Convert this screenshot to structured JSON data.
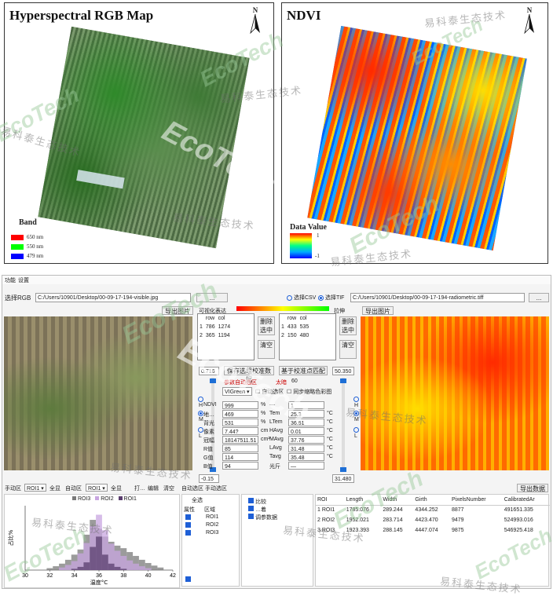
{
  "panel_rgb": {
    "title": "Hyperspectral RGB Map",
    "north": "N",
    "band_title": "Band",
    "bands": [
      {
        "label": "650 nm",
        "color": "#ff0000"
      },
      {
        "label": "550 nm",
        "color": "#00ff00"
      },
      {
        "label": "479 nm",
        "color": "#0000ff"
      }
    ]
  },
  "panel_ndvi": {
    "title": "NDVI",
    "north": "N",
    "legend_title": "Data Value",
    "legend_max": "1",
    "legend_min": "-1"
  },
  "watermark": {
    "en": "EcoTech",
    "cn": "易科泰生态技术"
  },
  "app": {
    "menu": [
      "功能",
      "设置"
    ],
    "select_rgb": "选择RGB",
    "rgb_path": "C:/Users/10901/Desktop/00-09-17-194-visible.jpg",
    "browse": "...",
    "select_csv": "选择CSV",
    "select_tif": "选择TIF",
    "tif_path": "C:/Users/10901/Desktop/00-09-17-194-radiometric.tiff",
    "browse2": "...",
    "export_img_left": "导出图片",
    "export_img_right": "导出图片",
    "vis_label": "可视化表达",
    "bar_right": "拉伸",
    "table_left": {
      "headers": [
        "row",
        "col"
      ],
      "rows": [
        [
          "1",
          "786",
          "1274"
        ],
        [
          "2",
          "365",
          "1194"
        ]
      ]
    },
    "table_right": {
      "headers": [
        "row",
        "col"
      ],
      "rows": [
        [
          "1",
          "433",
          "535"
        ],
        [
          "2",
          "150",
          "480"
        ]
      ]
    },
    "delete_sel": "删除选中",
    "clear": "清空",
    "delete_sel2": "删除选中",
    "clear2": "清空",
    "left_top_val": "0.716",
    "left_bot_val": "-0.15",
    "right_top_val": "50.350",
    "right_bot_val": "31.480",
    "save_reg": "保存选组校准数据",
    "feature_reg": "基于校准点匹配",
    "param_auto": "参数自动选区",
    "too_large": "太暗",
    "too_large_val": "60",
    "vi_select": "VIGreen",
    "auto_select": "自动选区",
    "scan_export": "同步缩略色彩图",
    "metrics_left": [
      {
        "label": "NDVI",
        "value": "999"
      },
      {
        "label": "地…",
        "value": "469"
      },
      {
        "label": "背光",
        "value": "531"
      },
      {
        "label": "像素",
        "value": "7.44?"
      },
      {
        "label": "冠幅",
        "value": "18147511.51"
      },
      {
        "label": "R值",
        "value": "85"
      },
      {
        "label": "G值",
        "value": "114"
      },
      {
        "label": "B值",
        "value": "94"
      }
    ],
    "units_left": [
      "%",
      "%",
      "%",
      "cm",
      "cm²",
      "",
      "",
      ""
    ],
    "metrics_right": [
      {
        "label": "—",
        "value": "1"
      },
      {
        "label": "Tem",
        "value": "25.3"
      },
      {
        "label": "LTem",
        "value": "36.51"
      },
      {
        "label": "HAvg",
        "value": "0.01"
      },
      {
        "label": "MAvg",
        "value": "37.76"
      },
      {
        "label": "LAvg",
        "value": "31.48"
      },
      {
        "label": "Tavg",
        "value": "35.48"
      },
      {
        "label": "光斤",
        "value": "—"
      }
    ],
    "units_right": [
      "",
      "°C",
      "°C",
      "°C",
      "°C",
      "°C",
      "°C",
      ""
    ],
    "radio_h": "H",
    "radio_m": "M",
    "radio_l": "L",
    "bottom_toolbar_left": [
      "手动区",
      "ROI1",
      "全显",
      "自动区",
      "ROI1",
      "全显",
      "打…"
    ],
    "bottom_toolbar_mid": [
      "编辑",
      "清空",
      "自动选区",
      "手动选区"
    ],
    "export_data": "导出数据",
    "hist_legend": [
      "ROI3",
      "ROI2",
      "ROI1"
    ],
    "hist_ylabel": "占比%",
    "hist_xlabel": "温度°C",
    "hist_xticks": [
      "30",
      "32",
      "34",
      "36",
      "38",
      "40",
      "42"
    ],
    "roi_panel": {
      "select_all": "全选",
      "col_show": "属性",
      "col_region": "区域",
      "rows": [
        "ROI1",
        "ROI2",
        "ROI3"
      ]
    },
    "layer_panel": {
      "items": [
        "比较",
        "…着",
        "调参数据"
      ]
    },
    "results": {
      "headers": [
        "ROI",
        "Length",
        "Width",
        "Girth",
        "PixelsNumber",
        "CalibratedAr"
      ],
      "rows": [
        [
          "1 ROI1",
          "1785.076",
          "289.244",
          "4344.252",
          "8877",
          "491651.335"
        ],
        [
          "2 ROI2",
          "1952.021",
          "283.714",
          "4423.470",
          "9479",
          "524993.016"
        ],
        [
          "3 ROI3",
          "1923.393",
          "288.145",
          "4447.074",
          "9875",
          "546925.418"
        ]
      ]
    }
  },
  "chart_data": {
    "type": "bar",
    "series": [
      {
        "name": "ROI3",
        "color": "#7a7a7a",
        "x": [
          32,
          32.5,
          33,
          33.5,
          34,
          34.5,
          35,
          35.5,
          36,
          36.5,
          37,
          37.5,
          38,
          38.5,
          39,
          39.5,
          40,
          40.5,
          41
        ],
        "values": [
          0.3,
          0.6,
          1.0,
          1.6,
          2.4,
          3.2,
          5.5,
          7.8,
          6.4,
          5.2,
          4.4,
          3.8,
          3.4,
          2.8,
          2.2,
          1.6,
          1.1,
          0.7,
          0.4
        ]
      },
      {
        "name": "ROI2",
        "color": "#c8a6e0",
        "x": [
          33,
          33.5,
          34,
          34.5,
          35,
          35.5,
          36,
          36.5,
          37,
          37.5,
          38,
          38.5,
          39,
          39.5,
          40
        ],
        "values": [
          0.4,
          0.8,
          1.4,
          2.6,
          4.2,
          6.8,
          8.6,
          6.2,
          4.1,
          3.0,
          2.2,
          1.5,
          1.0,
          0.6,
          0.3
        ]
      },
      {
        "name": "ROI1",
        "color": "#5a3d6e",
        "x": [
          34,
          34.5,
          35,
          35.5,
          36,
          36.5,
          37,
          37.5,
          38
        ],
        "values": [
          0.2,
          0.5,
          1.2,
          3.6,
          5.2,
          2.4,
          1.0,
          0.5,
          0.2
        ]
      }
    ],
    "xlabel": "温度°C",
    "ylabel": "占比%",
    "xlim": [
      30,
      42
    ],
    "ylim": [
      0,
      10
    ],
    "xticks": [
      30,
      32,
      34,
      36,
      38,
      40,
      42
    ]
  }
}
